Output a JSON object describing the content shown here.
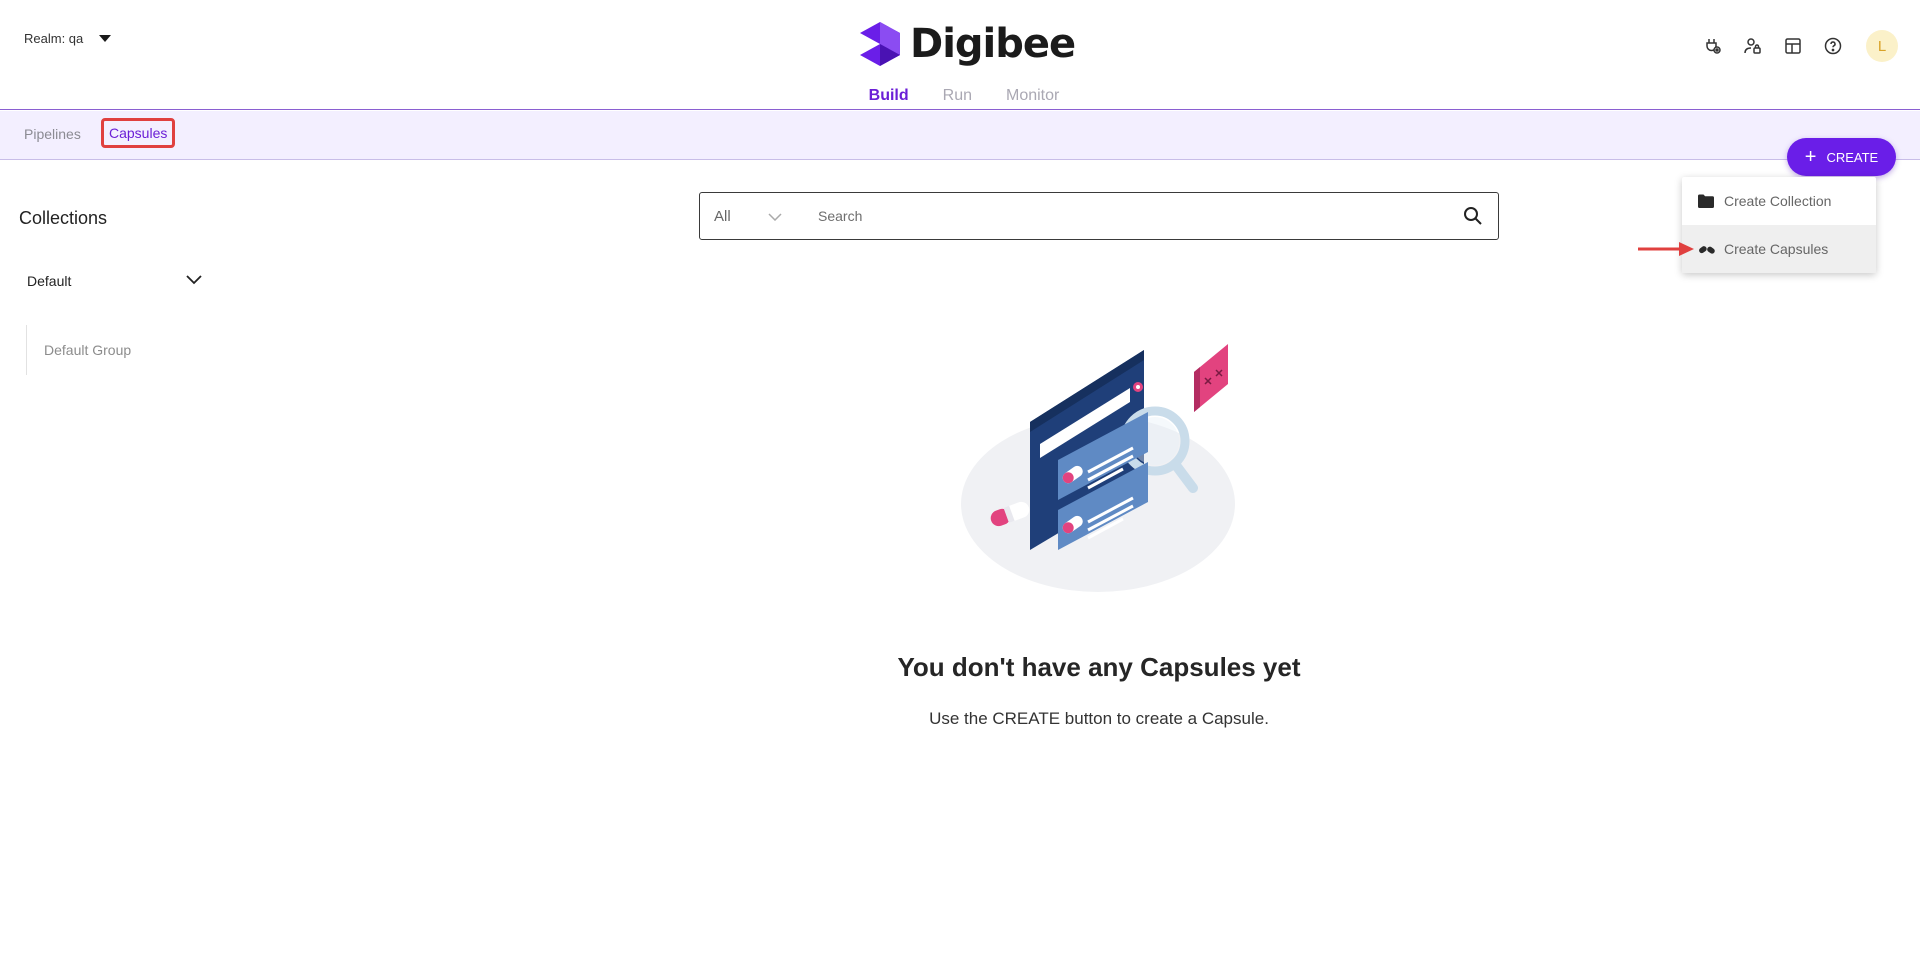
{
  "header": {
    "realm_label": "Realm: qa",
    "logo_text": "Digibee",
    "tabs": [
      {
        "label": "Build",
        "active": true
      },
      {
        "label": "Run",
        "active": false
      },
      {
        "label": "Monitor",
        "active": false
      }
    ],
    "icons": [
      "plug-settings-icon",
      "user-lock-icon",
      "table-icon",
      "help-icon"
    ],
    "avatar_initial": "L"
  },
  "subnav": {
    "tabs": [
      {
        "label": "Pipelines",
        "selected": false
      },
      {
        "label": "Capsules",
        "selected": true
      }
    ]
  },
  "create_button": {
    "label": "CREATE",
    "icon": "plus-icon"
  },
  "create_menu": {
    "items": [
      {
        "label": "Create Collection",
        "icon": "folder-icon"
      },
      {
        "label": "Create Capsules",
        "icon": "capsules-icon"
      }
    ]
  },
  "sidebar": {
    "title": "Collections",
    "collection": "Default",
    "groups": [
      "Default Group"
    ]
  },
  "search": {
    "type_value": "All",
    "placeholder": "Search"
  },
  "empty_state": {
    "title": "You don't have any Capsules yet",
    "subtitle": "Use the CREATE button to create a Capsule."
  },
  "colors": {
    "accent": "#6a1ee8",
    "highlight": "#e0403f",
    "subnav_bg": "#f3efff"
  }
}
